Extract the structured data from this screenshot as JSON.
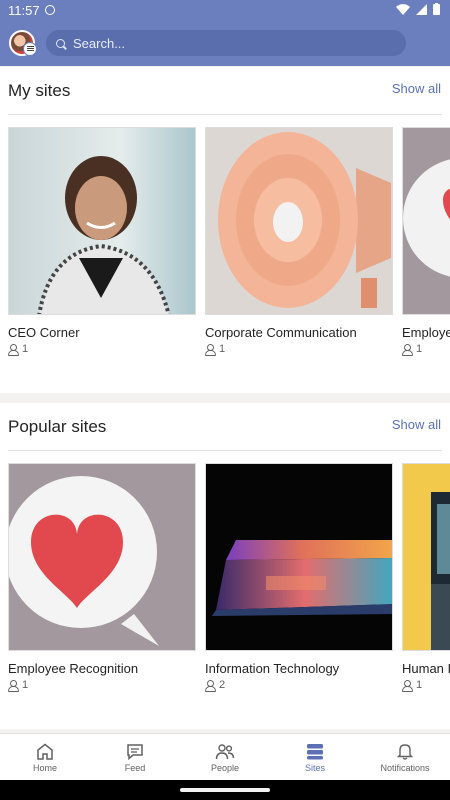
{
  "status_bar": {
    "time": "11:57"
  },
  "search": {
    "placeholder": "Search..."
  },
  "my_sites": {
    "title": "My sites",
    "show_all": "Show all",
    "cards": [
      {
        "title": "CEO Corner",
        "members": "1"
      },
      {
        "title": "Corporate Communication",
        "members": "1"
      },
      {
        "title": "Employe",
        "members": "1"
      }
    ]
  },
  "popular_sites": {
    "title": "Popular sites",
    "show_all": "Show all",
    "cards": [
      {
        "title": "Employee Recognition",
        "members": "1"
      },
      {
        "title": "Information Technology",
        "members": "2"
      },
      {
        "title": "Human I",
        "members": "1"
      }
    ]
  },
  "bottom_nav": {
    "items": [
      {
        "label": "Home",
        "icon": "home-icon"
      },
      {
        "label": "Feed",
        "icon": "chat-icon"
      },
      {
        "label": "People",
        "icon": "people-icon"
      },
      {
        "label": "Sites",
        "icon": "sites-icon",
        "active": true
      },
      {
        "label": "Notifications",
        "icon": "bell-icon"
      }
    ]
  },
  "colors": {
    "brand": "#6b7fbf",
    "accent": "#5b70b5"
  }
}
